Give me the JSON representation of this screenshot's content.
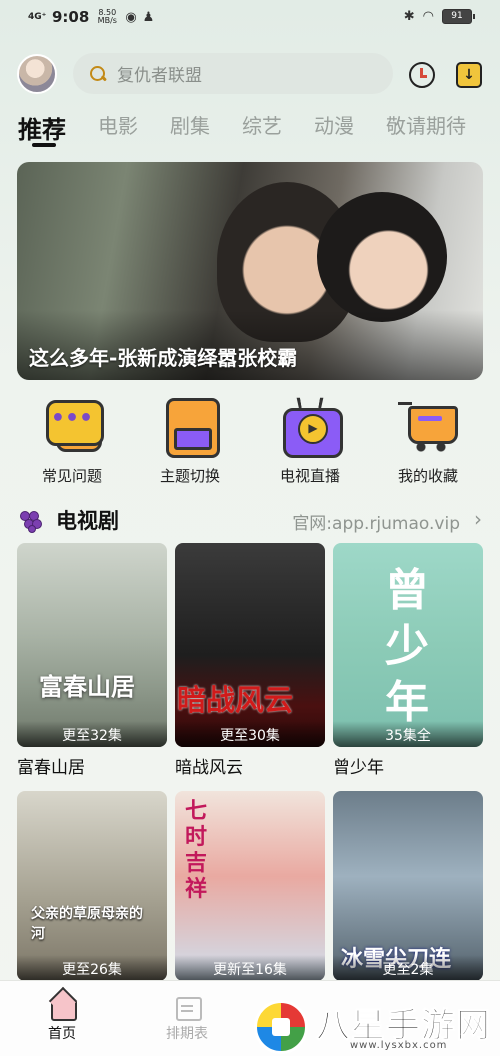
{
  "status_bar": {
    "signal": "4G⁺",
    "time": "9:08",
    "net_speed": "8.50 MB/s",
    "battery": "91"
  },
  "header": {
    "search_placeholder": "复仇者联盟"
  },
  "tabs": [
    {
      "label": "推荐",
      "active": true
    },
    {
      "label": "电影"
    },
    {
      "label": "剧集"
    },
    {
      "label": "综艺"
    },
    {
      "label": "动漫"
    },
    {
      "label": "敬请期待"
    }
  ],
  "banner": {
    "title": "这么多年-张新成演绎嚣张校霸"
  },
  "quick_actions": [
    {
      "label": "常见问题",
      "icon": "faq-chat-icon"
    },
    {
      "label": "主题切换",
      "icon": "theme-save-icon"
    },
    {
      "label": "电视直播",
      "icon": "tv-live-icon"
    },
    {
      "label": "我的收藏",
      "icon": "favorites-cart-icon"
    }
  ],
  "section": {
    "title": "电视剧",
    "link": "官网:app.rjumao.vip",
    "icon": "grape-icon"
  },
  "posters": [
    {
      "title": "富春山居",
      "badge": "更至32集",
      "art_text": "富春山居"
    },
    {
      "title": "暗战风云",
      "badge": "更至30集",
      "art_text": "暗战风云"
    },
    {
      "title": "曾少年",
      "badge": "35集全",
      "art_text": "曾少年"
    },
    {
      "title": "",
      "badge": "更至26集",
      "art_text": "父亲的草原母亲的河"
    },
    {
      "title": "",
      "badge": "更新至16集",
      "art_text": "七时吉祥"
    },
    {
      "title": "",
      "badge": "更至2集",
      "art_text": "冰雪尖刀连"
    }
  ],
  "bottom_nav": [
    {
      "label": "首页",
      "active": true
    },
    {
      "label": "排期表"
    }
  ],
  "watermark": {
    "text": "八星手游网",
    "url": "www.lysxbx.com"
  }
}
